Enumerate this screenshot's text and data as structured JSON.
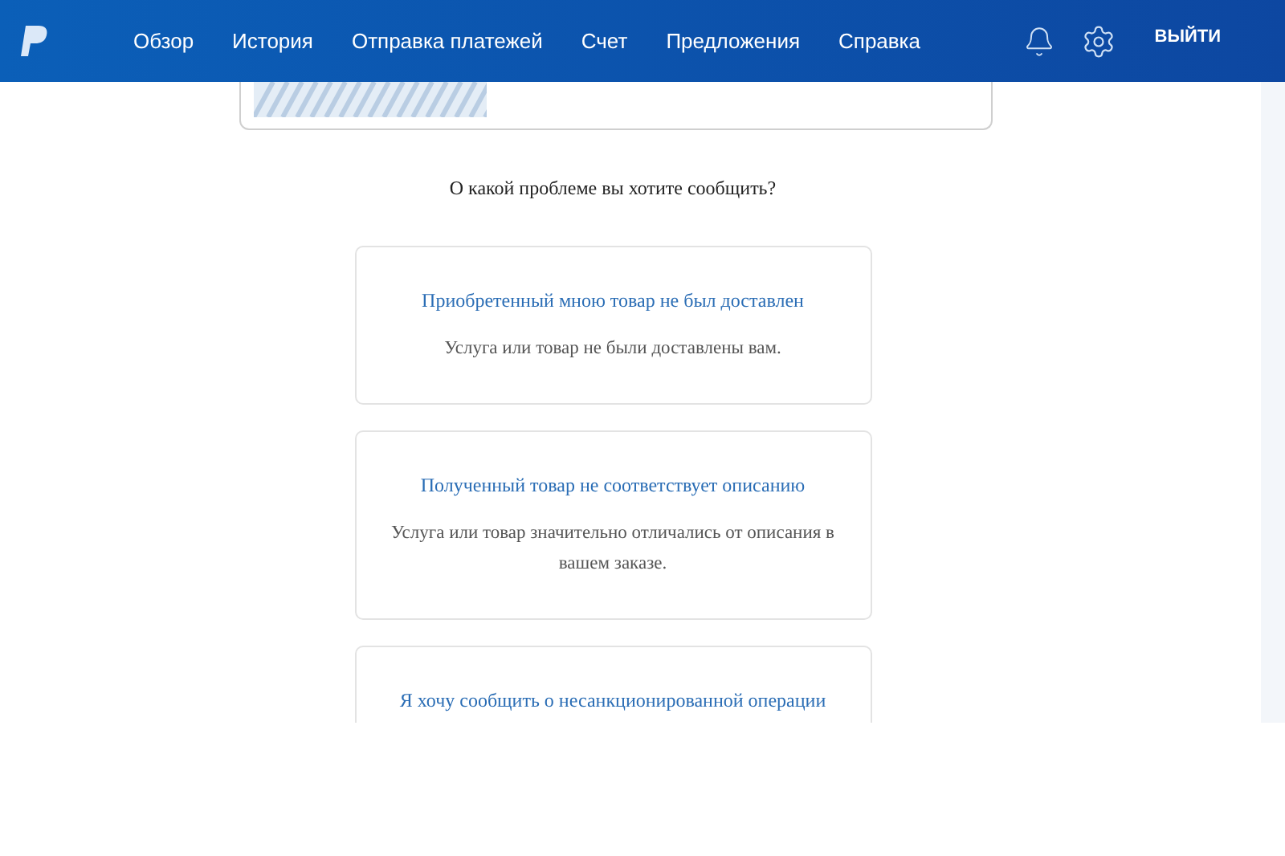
{
  "nav": {
    "items": [
      {
        "label": "Обзор"
      },
      {
        "label": "История"
      },
      {
        "label": "Отправка платежей"
      },
      {
        "label": "Счет"
      },
      {
        "label": "Предложения"
      },
      {
        "label": "Справка"
      }
    ],
    "logout": "ВЫЙТИ"
  },
  "question": "О какой проблеме вы хотите сообщить?",
  "options": [
    {
      "title": "Приобретенный мною товар не был доставлен",
      "description": "Услуга или товар не были доставлены вам."
    },
    {
      "title": "Полученный товар не соответствует описанию",
      "description": "Услуга или товар значительно отличались от описания в вашем заказе."
    },
    {
      "title": "Я хочу сообщить о несанкционированной операции"
    }
  ]
}
